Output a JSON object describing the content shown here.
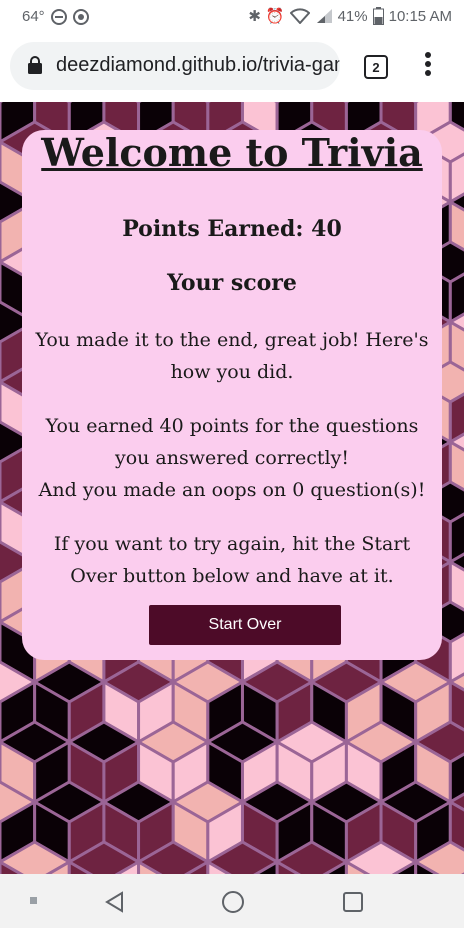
{
  "status_bar": {
    "temperature": "64°",
    "battery_percent": "41%",
    "time": "10:15 AM"
  },
  "browser": {
    "url": "deezdiamond.github.io/trivia-game",
    "tab_count": "2"
  },
  "card": {
    "title": "Welcome to Trivia",
    "points_text": "Points Earned: 40",
    "score_heading": "Your score",
    "message": "You made it to the end, great job! Here's how you did.",
    "earned_line": "You earned 40 points for the questions you answered correctly!",
    "oops_line": "And you made an oops on 0 question(s)!",
    "retry_text": "If you want to try again, hit the Start Over button below and have at it.",
    "start_over_label": "Start Over"
  },
  "colors": {
    "card_background": "#fbcdee",
    "button_background": "#4d0b28",
    "pattern_dark": "#0a0106",
    "pattern_plum": "#6e2341",
    "pattern_pink": "#f2b3b0",
    "pattern_light": "#fbc3d4",
    "pattern_outline": "#9b6596"
  }
}
